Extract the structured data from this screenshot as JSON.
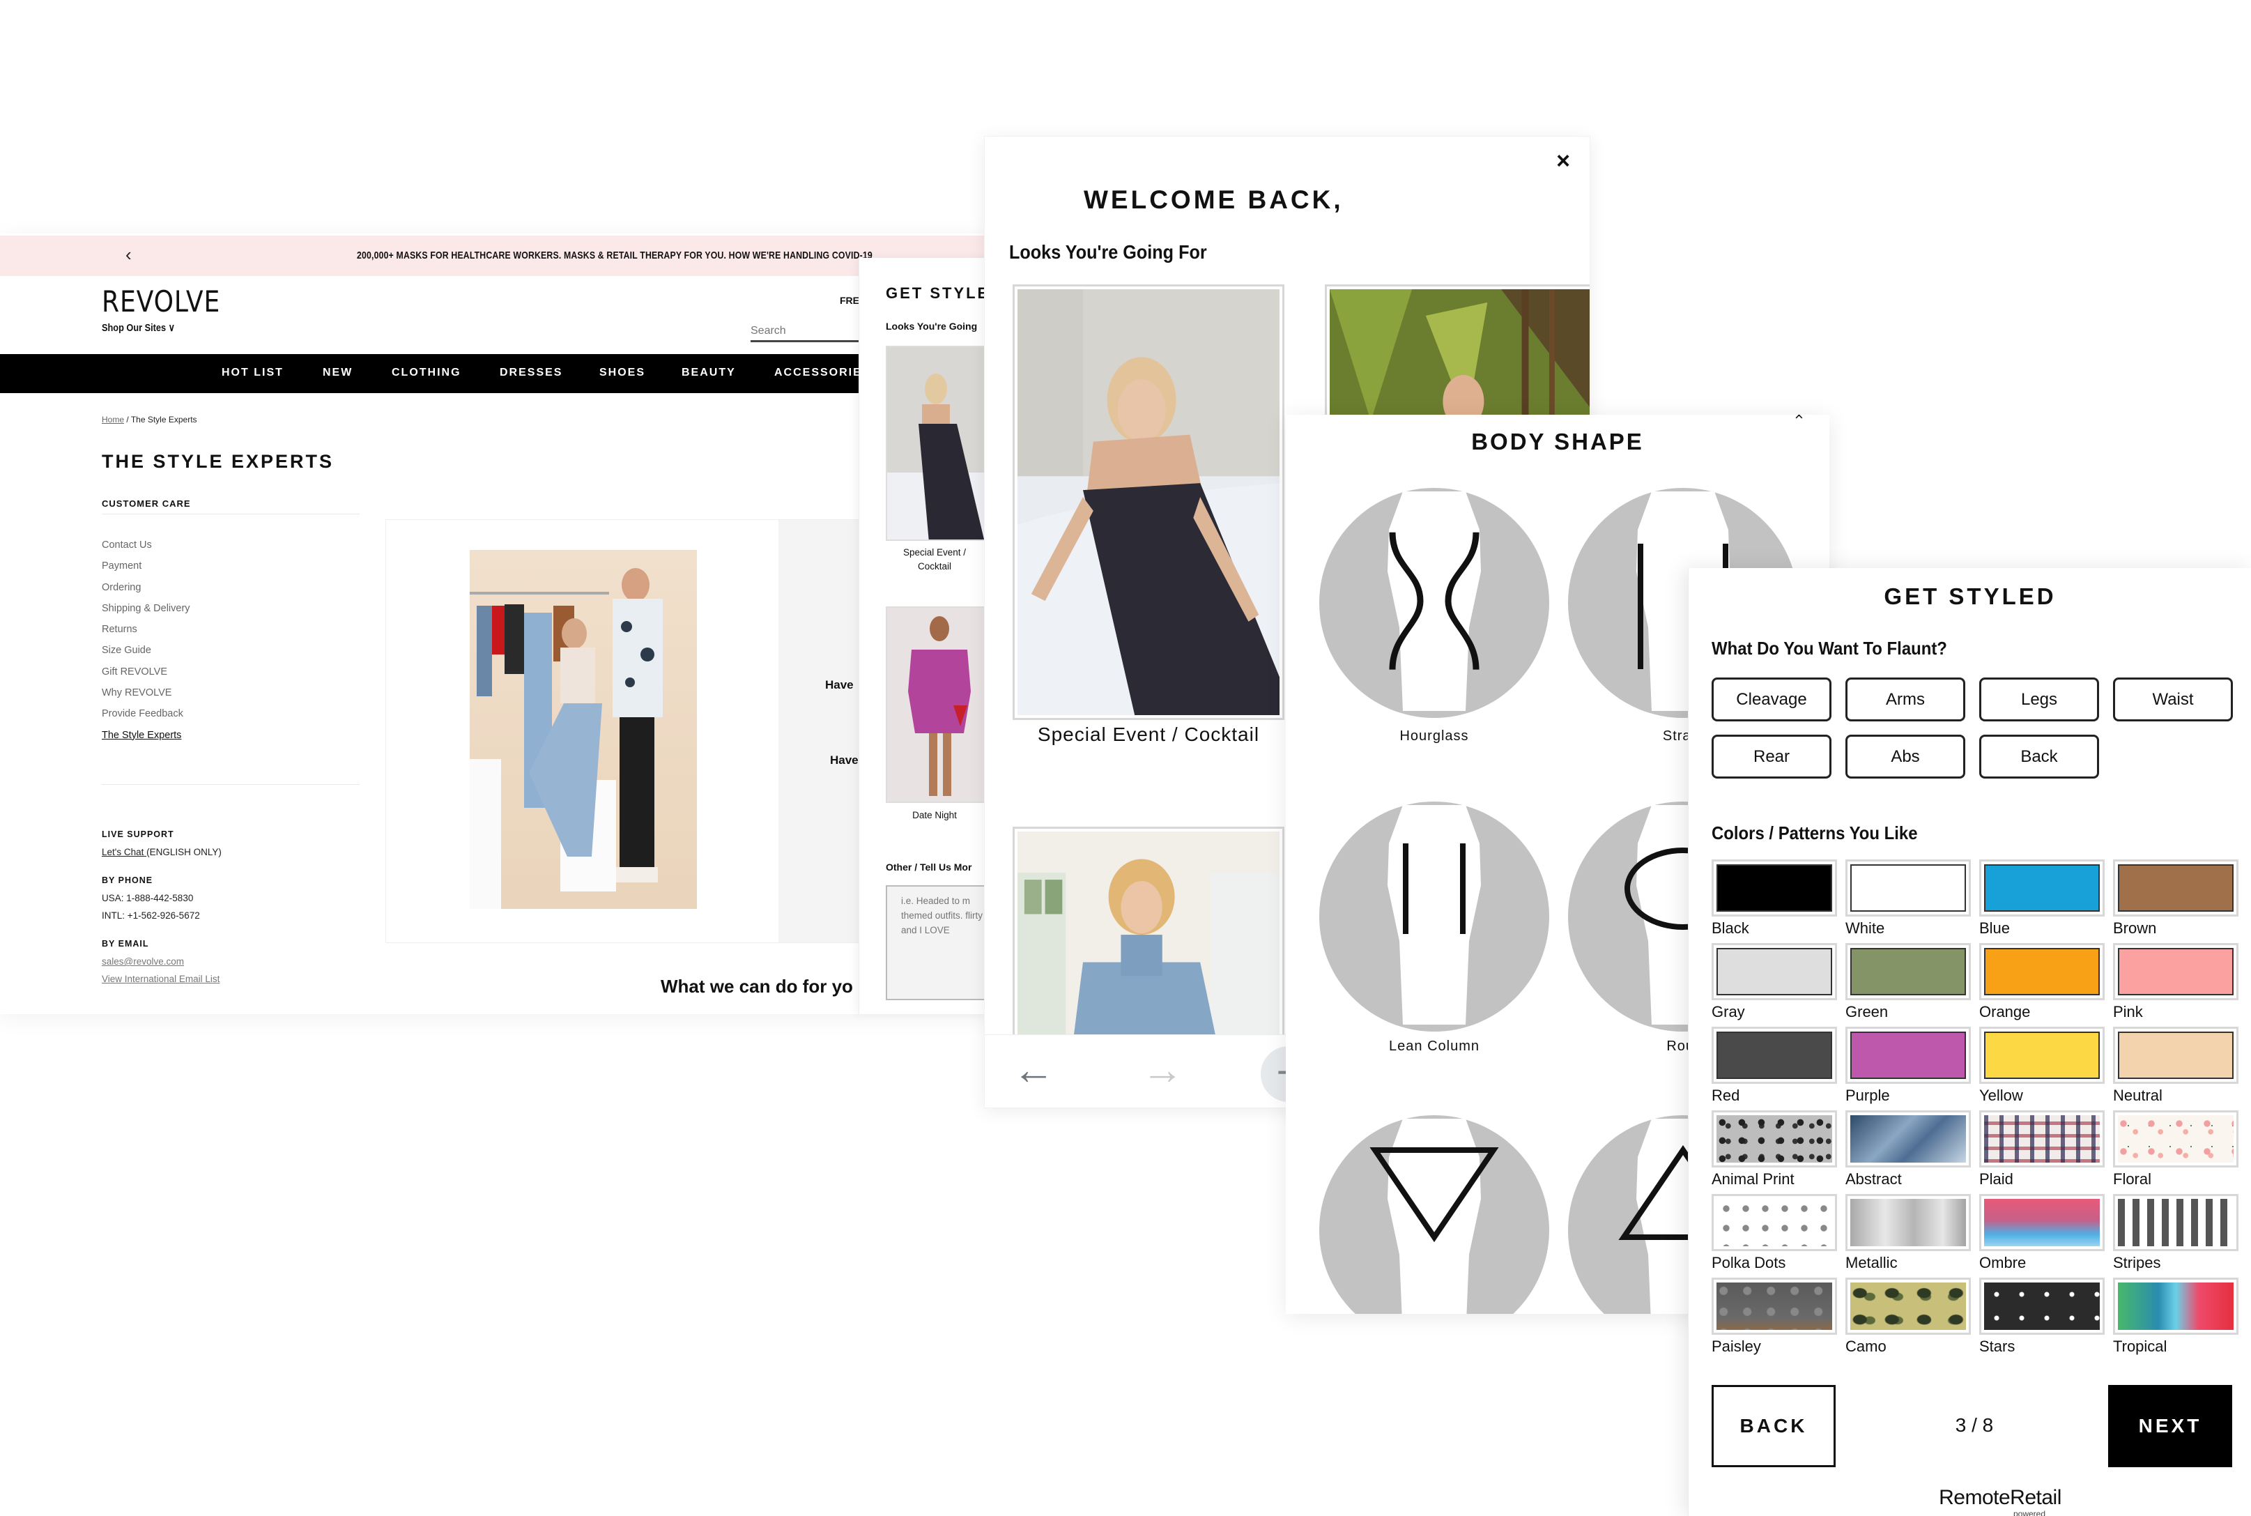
{
  "site": {
    "promo": {
      "prev_icon": "chevron-left",
      "message": "200,000+ MASKS FOR HEALTHCARE WORKERS. MASKS & RETAIL THERAPY FOR YOU. HOW WE'RE HANDLING COVID-19"
    },
    "logo": "REVOLVE",
    "shop_sites": "Shop Our Sites ∨",
    "free_label": "FRE",
    "search_placeholder": "Search",
    "nav": [
      "HOT LIST",
      "NEW",
      "CLOTHING",
      "DRESSES",
      "SHOES",
      "BEAUTY",
      "ACCESSORIES"
    ],
    "breadcrumb": {
      "home": "Home",
      "sep": "/",
      "current": "The Style Experts"
    },
    "page_title": "THE STYLE EXPERTS",
    "customer_care": {
      "heading": "CUSTOMER CARE",
      "items": [
        "Contact Us",
        "Payment",
        "Ordering",
        "Shipping & Delivery",
        "Returns",
        "Size Guide",
        "Gift REVOLVE",
        "Why REVOLVE",
        "Provide Feedback",
        "The Style Experts"
      ],
      "active_index": 9
    },
    "support": {
      "live_heading": "LIVE SUPPORT",
      "chat_link": "Let's Chat ",
      "chat_note": "(ENGLISH ONLY)",
      "phone_heading": "BY PHONE",
      "usa": "USA: 1-888-442-5830",
      "intl": "INTL: +1-562-926-5672",
      "email_heading": "BY EMAIL",
      "email": "sales@revolve.com",
      "intl_email": "View International Email List"
    },
    "feature": {
      "have_1": "Have",
      "have_2": "Have"
    },
    "what_we_can_do": "What we can do for yo"
  },
  "get_styled_small": {
    "title": "GET STYLED",
    "subtitle": "Looks You're Going",
    "looks": [
      {
        "caption": "Special Event / Cocktail"
      },
      {
        "caption": "Date Night"
      }
    ],
    "other_label": "Other / Tell Us Mor",
    "other_placeholder": "i.e. Headed to m themed outfits. flirty and I LOVE"
  },
  "welcome": {
    "close_icon": "×",
    "title": "WELCOME BACK,",
    "subtitle": "Looks You're Going For",
    "looks": [
      {
        "caption": "Special Event / Cocktail"
      }
    ],
    "nav": {
      "back": "←",
      "forward": "→",
      "add": "+"
    }
  },
  "body_shape": {
    "title": "BODY SHAPE",
    "shapes": [
      {
        "label": "Hourglass",
        "icon": "hourglass"
      },
      {
        "label": "Straig",
        "icon": "straight"
      },
      {
        "label": "Lean Column",
        "icon": "lean-column"
      },
      {
        "label": "Rour",
        "icon": "round"
      },
      {
        "label": "",
        "icon": "inverted-triangle"
      },
      {
        "label": "",
        "icon": "triangle"
      }
    ]
  },
  "get_styled": {
    "title": "GET STYLED",
    "flaunt_question": "What Do You Want To Flaunt?",
    "flaunt_options": [
      "Cleavage",
      "Arms",
      "Legs",
      "Waist",
      "Rear",
      "Abs",
      "Back"
    ],
    "colors_heading": "Colors / Patterns You Like",
    "swatches": [
      {
        "label": "Black",
        "color": "#000000"
      },
      {
        "label": "White",
        "color": "#ffffff"
      },
      {
        "label": "Blue",
        "color": "#18a0d8"
      },
      {
        "label": "Brown",
        "color": "#a0704a"
      },
      {
        "label": "Gray",
        "color": "#dedede"
      },
      {
        "label": "Green",
        "color": "#849466"
      },
      {
        "label": "Orange",
        "color": "#f8a016"
      },
      {
        "label": "Pink",
        "color": "#fba2a0"
      },
      {
        "label": "Red",
        "color": "#4a4a4a"
      },
      {
        "label": "Purple",
        "color": "#bd58ad"
      },
      {
        "label": "Yellow",
        "color": "#fcd944"
      },
      {
        "label": "Neutral",
        "color": "#f2d3ad"
      },
      {
        "label": "Animal Print",
        "pattern": "animal"
      },
      {
        "label": "Abstract",
        "pattern": "abstract"
      },
      {
        "label": "Plaid",
        "pattern": "plaid"
      },
      {
        "label": "Floral",
        "pattern": "floral"
      },
      {
        "label": "Polka Dots",
        "pattern": "polka"
      },
      {
        "label": "Metallic",
        "pattern": "metallic"
      },
      {
        "label": "Ombre",
        "pattern": "ombre"
      },
      {
        "label": "Stripes",
        "pattern": "stripes"
      },
      {
        "label": "Paisley",
        "pattern": "paisley"
      },
      {
        "label": "Camo",
        "pattern": "camo"
      },
      {
        "label": "Stars",
        "pattern": "stars"
      },
      {
        "label": "Tropical",
        "pattern": "tropical"
      }
    ],
    "back_label": "BACK",
    "next_label": "NEXT",
    "step": "3 / 8",
    "brand": "RemoteRetail",
    "powered": "powered"
  }
}
